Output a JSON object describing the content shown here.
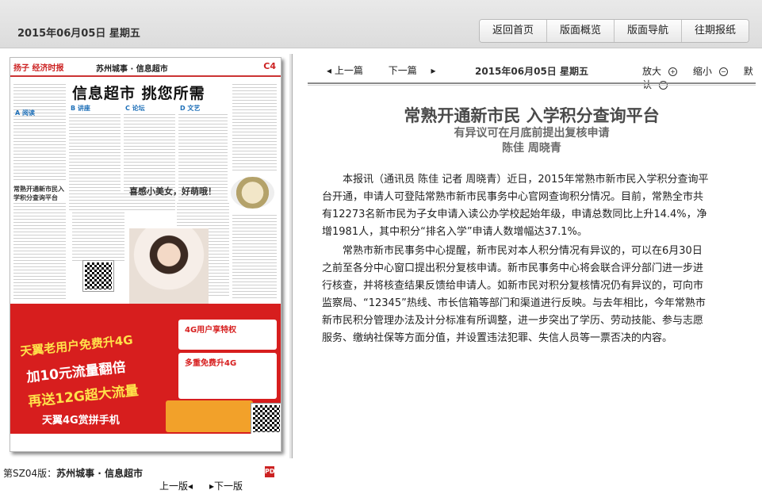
{
  "header": {
    "date": "2015年06月05日  星期五",
    "buttons": [
      "返回首页",
      "版面概览",
      "版面导航",
      "往期报纸"
    ]
  },
  "newspaper": {
    "brand": "扬子 经济时报",
    "section": "苏州城事 · 信息超市",
    "page_no": "C4",
    "headline": "信息超市  挑您所需",
    "col_labels": [
      "A 阅读",
      "B 讲座",
      "C 论坛",
      "D 文艺"
    ],
    "side_title": "常熟开通新市民入学积分查询平台",
    "girl_title": "喜感小美女，好萌哦！",
    "ad_line1": "天翼老用户免费升4G",
    "ad_line2": "加10元流量翻倍",
    "ad_line3": "再送12G超大流量",
    "ad_line4": "天翼4G赏拼手机",
    "ad_box1": "4G用户享特权",
    "ad_box2": "多重免费升4G"
  },
  "page_label": {
    "code": "第SZ04版：",
    "name": "苏州城事 · 信息超市"
  },
  "pdf_icon": "pdf-icon",
  "pager": {
    "prev": "上一版",
    "next": "下一版"
  },
  "article_nav": {
    "prev": "上一篇",
    "next": "下一篇",
    "date": "2015年06月05日  星期五"
  },
  "zoom": {
    "in": "放大",
    "out": "缩小",
    "default": "默认"
  },
  "article": {
    "title": "常熟开通新市民 入学积分查询平台",
    "subtitle": "有异议可在月底前提出复核申请",
    "author": "陈佳 周晓青",
    "paragraphs": [
      "本报讯（通讯员 陈佳 记者 周晓青）近日，2015年常熟市新市民入学积分查询平台开通，申请人可登陆常熟市新市民事务中心官网查询积分情况。目前，常熟全市共有12273名新市民为子女申请入读公办学校起始年级，申请总数同比上升14.4%，净增1981人，其中积分“排名入学”申请人数增幅达37.1%。",
      "常熟市新市民事务中心提醒，新市民对本人积分情况有异议的，可以在6月30日之前至各分中心窗口提出积分复核申请。新市民事务中心将会联合评分部门进一步进行核查，并将核查结果反馈给申请人。如新市民对积分复核情况仍有异议的，可向市监察局、“12345”热线、市长信箱等部门和渠道进行反映。与去年相比，今年常熟市新市民积分管理办法及计分标准有所调整，进一步突出了学历、劳动技能、参与志愿服务、缴纳社保等方面分值，并设置违法犯罪、失信人员等一票否决的内容。"
    ]
  }
}
